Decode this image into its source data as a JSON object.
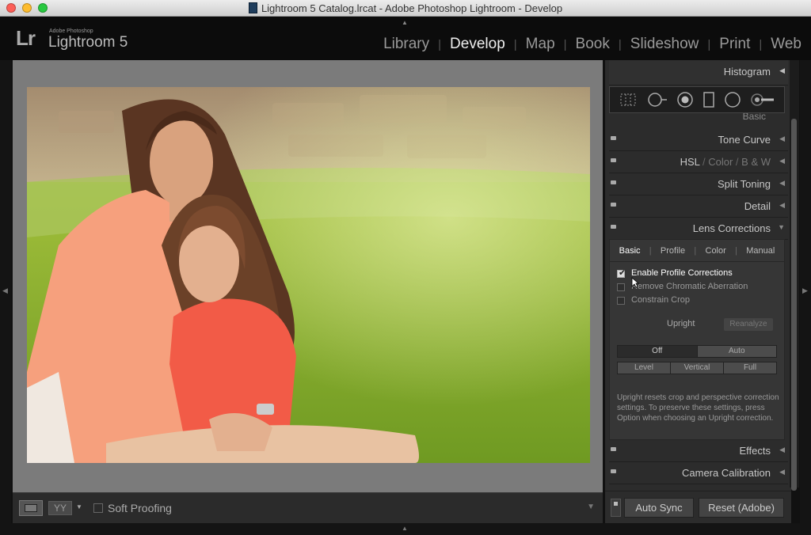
{
  "window": {
    "title": "Lightroom 5 Catalog.lrcat - Adobe Photoshop Lightroom - Develop"
  },
  "branding": {
    "logo": "Lr",
    "vendor": "Adobe Photoshop",
    "product": "Lightroom 5"
  },
  "modules": [
    "Library",
    "Develop",
    "Map",
    "Book",
    "Slideshow",
    "Print",
    "Web"
  ],
  "active_module": "Develop",
  "toolbar": {
    "view_mode_icon": "loupe-view-icon",
    "compare_label": "YY",
    "soft_proofing_label": "Soft Proofing",
    "soft_proofing_checked": false
  },
  "panels": {
    "histogram": "Histogram",
    "basic": "Basic",
    "tone_curve": "Tone Curve",
    "hsl": "HSL",
    "hsl_color": "Color",
    "hsl_bw": "B & W",
    "split_toning": "Split Toning",
    "detail": "Detail",
    "lens_corrections": "Lens Corrections",
    "effects": "Effects",
    "camera_calibration": "Camera Calibration"
  },
  "tools": [
    "crop-overlay-icon",
    "spot-removal-icon",
    "red-eye-icon",
    "graduated-filter-icon",
    "radial-filter-icon",
    "adjustment-brush-icon"
  ],
  "lens_corrections": {
    "tabs": [
      "Basic",
      "Profile",
      "Color",
      "Manual"
    ],
    "active_tab": "Basic",
    "enable_profile": {
      "label": "Enable Profile Corrections",
      "checked": true
    },
    "remove_ca": {
      "label": "Remove Chromatic Aberration",
      "checked": false
    },
    "constrain_crop": {
      "label": "Constrain Crop",
      "checked": false
    },
    "upright_label": "Upright",
    "reanalyze_label": "Reanalyze",
    "upright_row1": [
      "Off",
      "Auto"
    ],
    "upright_row2": [
      "Level",
      "Vertical",
      "Full"
    ],
    "upright_selected": "Off",
    "help_text": "Upright resets crop and perspective correction settings. To preserve these settings, press Option when choosing an Upright correction."
  },
  "bottom": {
    "auto_sync": "Auto Sync",
    "reset": "Reset (Adobe)"
  },
  "colors": {
    "accent": "#ffffff",
    "panel_bg": "#2c2c2c",
    "canvas_bg": "#7b7b7b"
  }
}
